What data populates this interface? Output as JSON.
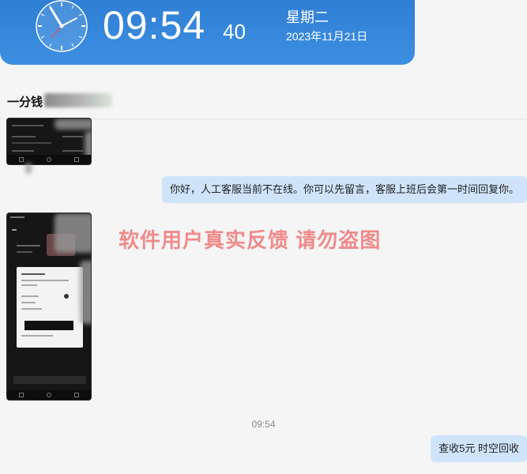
{
  "clock": {
    "time": "09:54",
    "seconds": "40",
    "weekday": "星期二",
    "date": "2023年11月21日"
  },
  "chat": {
    "contact_name": "一分钱",
    "messages": [
      {
        "from": "agent",
        "type": "image",
        "name": "phone-screenshot-1"
      },
      {
        "from": "agent",
        "type": "text",
        "text": "你好，人工客服当前不在线。你可以先留言，客服上班后会第一时间回复你。"
      },
      {
        "from": "user",
        "type": "image",
        "name": "phone-screenshot-2"
      },
      {
        "from": "agent",
        "type": "text",
        "text": "查收5元  时空回收"
      }
    ],
    "timestamp": "09:54"
  },
  "watermark": "软件用户真实反馈  请勿盗图",
  "colors": {
    "clock_bg": "#2f7fd4",
    "bubble_bg": "#cfe4fb",
    "watermark": "#f08a8a",
    "page_bg": "#f5f5f5"
  }
}
